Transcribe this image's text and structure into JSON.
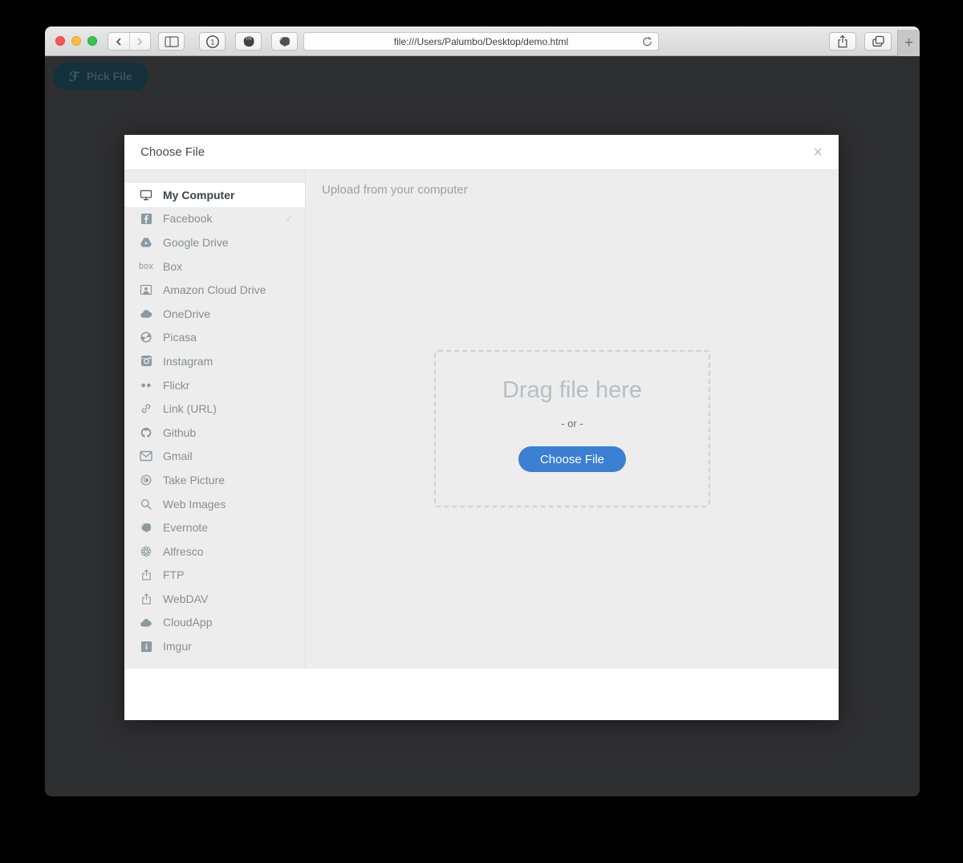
{
  "browser": {
    "url": "file:///Users/Palumbo/Desktop/demo.html",
    "new_tab_glyph": "+",
    "onepassword_glyph": "1",
    "toolbar_icons": [
      "back-icon",
      "forward-icon",
      "sidebar-toggle-icon",
      "onepassword-icon",
      "hand-extension-icon",
      "evernote-extension-icon",
      "reload-icon",
      "share-icon",
      "tab-overview-icon",
      "new-tab-icon"
    ]
  },
  "page": {
    "pick_file_logo": "ℱ",
    "pick_file_label": "Pick File"
  },
  "dialog": {
    "title": "Choose File",
    "close_glyph": "×",
    "sidebar": {
      "check_glyph": "✓",
      "items": [
        {
          "label": "My Computer",
          "icon": "monitor-icon",
          "selected": true
        },
        {
          "label": "Facebook",
          "icon": "facebook-icon",
          "checked": true
        },
        {
          "label": "Google Drive",
          "icon": "google-drive-icon"
        },
        {
          "label": "Box",
          "icon": "box-logo-icon",
          "icon_text": "box"
        },
        {
          "label": "Amazon Cloud Drive",
          "icon": "amazon-cloud-drive-icon"
        },
        {
          "label": "OneDrive",
          "icon": "onedrive-cloud-icon"
        },
        {
          "label": "Picasa",
          "icon": "picasa-shutter-icon"
        },
        {
          "label": "Instagram",
          "icon": "instagram-camera-icon"
        },
        {
          "label": "Flickr",
          "icon": "flickr-dots-icon"
        },
        {
          "label": "Link (URL)",
          "icon": "link-icon"
        },
        {
          "label": "Github",
          "icon": "github-octocat-icon"
        },
        {
          "label": "Gmail",
          "icon": "gmail-envelope-icon"
        },
        {
          "label": "Take Picture",
          "icon": "camera-lens-icon"
        },
        {
          "label": "Web Images",
          "icon": "search-icon"
        },
        {
          "label": "Evernote",
          "icon": "evernote-elephant-icon"
        },
        {
          "label": "Alfresco",
          "icon": "alfresco-flower-icon"
        },
        {
          "label": "FTP",
          "icon": "upload-box-icon"
        },
        {
          "label": "WebDAV",
          "icon": "upload-box-icon"
        },
        {
          "label": "CloudApp",
          "icon": "cloud-filled-icon"
        },
        {
          "label": "Imgur",
          "icon": "imgur-icon"
        }
      ]
    },
    "main": {
      "header": "Upload from your computer",
      "dropzone": {
        "drag_label": "Drag file here",
        "or_label": "- or -",
        "choose_button": "Choose File"
      }
    }
  },
  "colors": {
    "accent_blue": "#3a7fd2",
    "page_overlay": "#2e2f31",
    "sidebar_icon_gray": "#8b99a2",
    "dialog_gray": "#ededed",
    "pick_button_teal": "#14303b"
  }
}
